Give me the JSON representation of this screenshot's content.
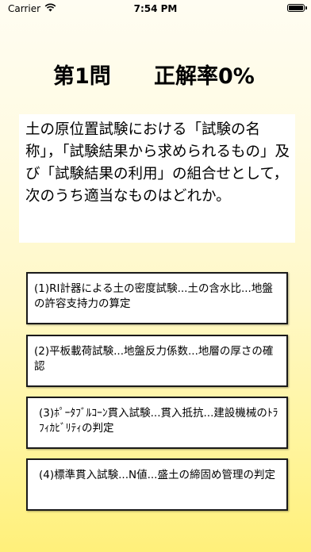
{
  "status_bar": {
    "carrier": "Carrier",
    "time": "7:54 PM",
    "icons": [
      "wifi-icon",
      "battery-icon"
    ]
  },
  "header": {
    "question_number": "第1問",
    "accuracy": "正解率0%"
  },
  "question": {
    "text": "土の原位置試験における「試験の名称」，「試験結果から求められるもの」及び「試験結果の利用」の組合せとして，次のうち適当なものはどれか。"
  },
  "choices": [
    {
      "label": "(1)RI計器による土の密度試験...土の含水比...地盤の許容支持力の算定"
    },
    {
      "label": "(2)平板載荷試験...地盤反力係数...地層の厚さの確認"
    },
    {
      "label": "(3)ﾎﾟｰﾀﾌﾞﾙｺｰﾝ貫入試験...貫入抵抗...建設機械のﾄﾗﾌｨｶﾋﾞﾘﾃｨの判定"
    },
    {
      "label": "(4)標準貫入試験...N値...盛土の締固め管理の判定"
    }
  ]
}
